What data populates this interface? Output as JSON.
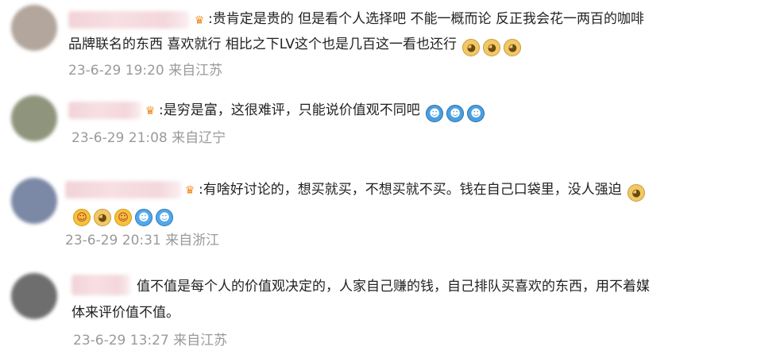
{
  "comments": [
    {
      "lines": [
        "贵肯定是贵的 但是看个人选择吧 不能一概而论 反正我会花一两百的咖啡",
        "品牌联名的东西 喜欢就行 相比之下LV这个也是几百这一看也还行"
      ],
      "prefix": ":",
      "emojis": [
        "doge",
        "doge",
        "doge"
      ],
      "time": "23-6-29 19:20",
      "location": "来自江苏",
      "avatar_color": "#b3a69c"
    },
    {
      "lines": [
        "是穷是富，这很难评，只能说价值观不同吧"
      ],
      "prefix": ":",
      "emojis": [
        "wave",
        "wave",
        "wave"
      ],
      "time": "23-6-29 21:08",
      "location": "来自辽宁",
      "avatar_color": "#8f957c"
    },
    {
      "lines": [
        "有啥好讨论的，想买就买，不想买就不买。钱在自己口袋里，没人强迫"
      ],
      "prefix": ":",
      "emojis_inline": [
        "doge"
      ],
      "emojis_line2": [
        "yum",
        "doge",
        "yum",
        "laugh",
        "laugh"
      ],
      "time": "23-6-29 20:31",
      "location": "来自浙江",
      "avatar_color": "#7b88a6"
    },
    {
      "lines": [
        "值不值是每个人的价值观决定的，人家自己赚的钱，自己排队买喜欢的东西，用不着媒",
        "体来评价值不值。"
      ],
      "prefix": "",
      "time": "23-6-29 13:27",
      "location": "来自江苏",
      "avatar_color": "#6e6e6e"
    }
  ],
  "emoji_glyphs": {
    "doge": "◕",
    "wave": "☻",
    "yum": "☺",
    "laugh": "☻"
  }
}
